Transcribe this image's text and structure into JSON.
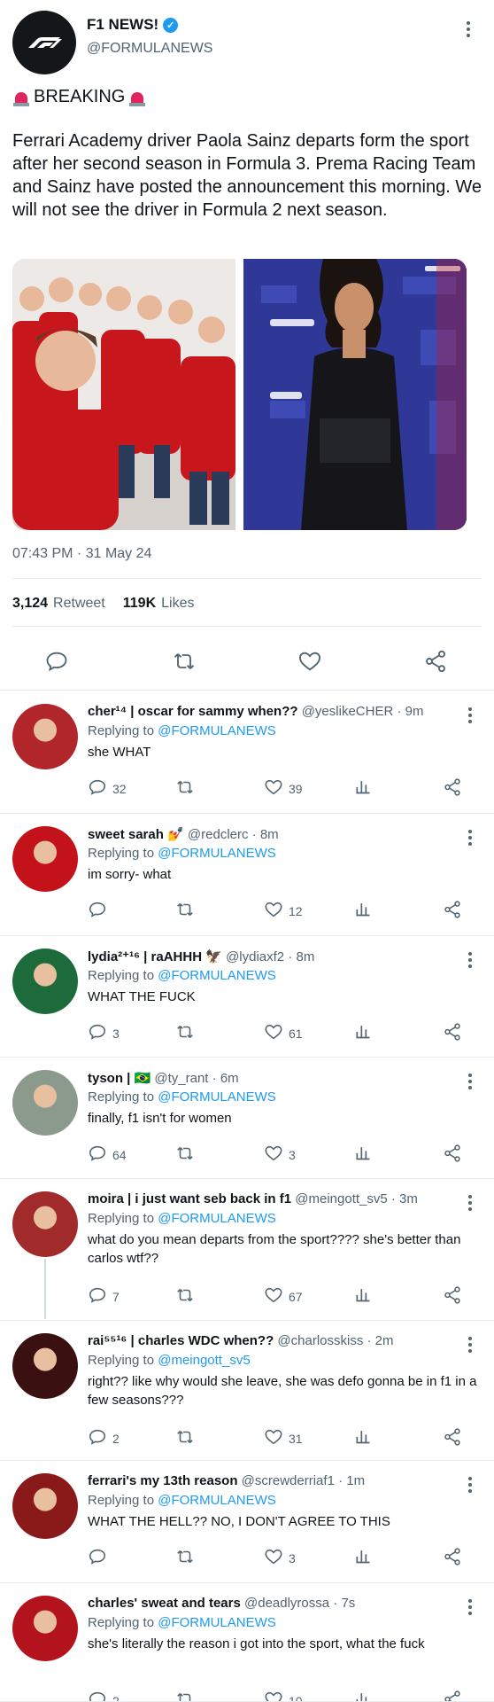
{
  "main": {
    "name": "F1 NEWS!",
    "handle": "@FORMULANEWS",
    "headline": "BREAKING",
    "text": "Ferrari Academy driver Paola Sainz departs form the sport after her second season in Formula 3. Prema Racing Team and Sainz have posted the announcement this morning. We will not see the driver in Formula 2 next season.",
    "timestamp": "07:43 PM · 31 May 24",
    "retweets": "3,124",
    "retweets_label": "Retweet",
    "likes": "119K",
    "likes_label": "Likes"
  },
  "replies": [
    {
      "name": "cher¹⁴ | oscar for sammy when??",
      "handle": "@yeslikeCHER",
      "time": "· 9m",
      "replying_label": "Replying to",
      "replying_to": "@FORMULANEWS",
      "text": "she WHAT",
      "replies": "32",
      "likes": "39",
      "avatar_color": "#b0262b"
    },
    {
      "name": "sweet sarah 💅",
      "handle": "@redclerc",
      "time": "· 8m",
      "replying_label": "Replying to",
      "replying_to": "@FORMULANEWS",
      "text": "im sorry- what",
      "replies": "",
      "likes": "12",
      "avatar_color": "#c4121a"
    },
    {
      "name": "lydia²⁺¹⁶ | raAHHH 🦅",
      "handle": "@lydiaxf2",
      "time": "· 8m",
      "replying_label": "Replying to",
      "replying_to": "@FORMULANEWS",
      "text": "WHAT THE FUCK",
      "replies": "3",
      "likes": "61",
      "avatar_color": "#1d6b3a"
    },
    {
      "name": "tyson | 🇧🇷",
      "handle": "@ty_rant",
      "time": "· 6m",
      "replying_label": "Replying to",
      "replying_to": "@FORMULANEWS",
      "text": "finally, f1 isn't for women",
      "replies": "64",
      "likes": "3",
      "avatar_color": "#8b9a8c"
    },
    {
      "name": "moira | i just want seb back in f1",
      "handle": "@meingott_sv5",
      "time": "· 3m",
      "replying_label": "Replying to",
      "replying_to": "@FORMULANEWS",
      "text": "what do you mean departs from the sport???? she's better than carlos wtf??",
      "replies": "7",
      "likes": "67",
      "avatar_color": "#a12a2a"
    },
    {
      "name": "rai⁵⁵¹⁶ | charles WDC when??",
      "handle": "@charlosskiss",
      "time": "· 2m",
      "replying_label": "Replying to",
      "replying_to": "@meingott_sv5",
      "text": "right?? like why would she leave, she was defo gonna be in f1 in a few seasons???",
      "replies": "2",
      "likes": "31",
      "avatar_color": "#3a1010"
    },
    {
      "name": "ferrari's my 13th reason",
      "handle": "@screwderriaf1",
      "time": "· 1m",
      "replying_label": "Replying to",
      "replying_to": "@FORMULANEWS",
      "text": "WHAT THE HELL?? NO, I DON'T AGREE TO THIS",
      "replies": "",
      "likes": "3",
      "avatar_color": "#8a1a1a"
    },
    {
      "name": "charles' sweat and tears",
      "handle": "@deadlyrossa",
      "time": "· 7s",
      "replying_label": "Replying to",
      "replying_to": "@FORMULANEWS",
      "text": "she's literally the reason i got into the sport, what the fuck",
      "replies": "2",
      "likes": "10",
      "avatar_color": "#b3131c"
    }
  ],
  "colors": {
    "accent": "#1d9bf0",
    "muted": "#536471",
    "divider": "#e6ecf0"
  }
}
